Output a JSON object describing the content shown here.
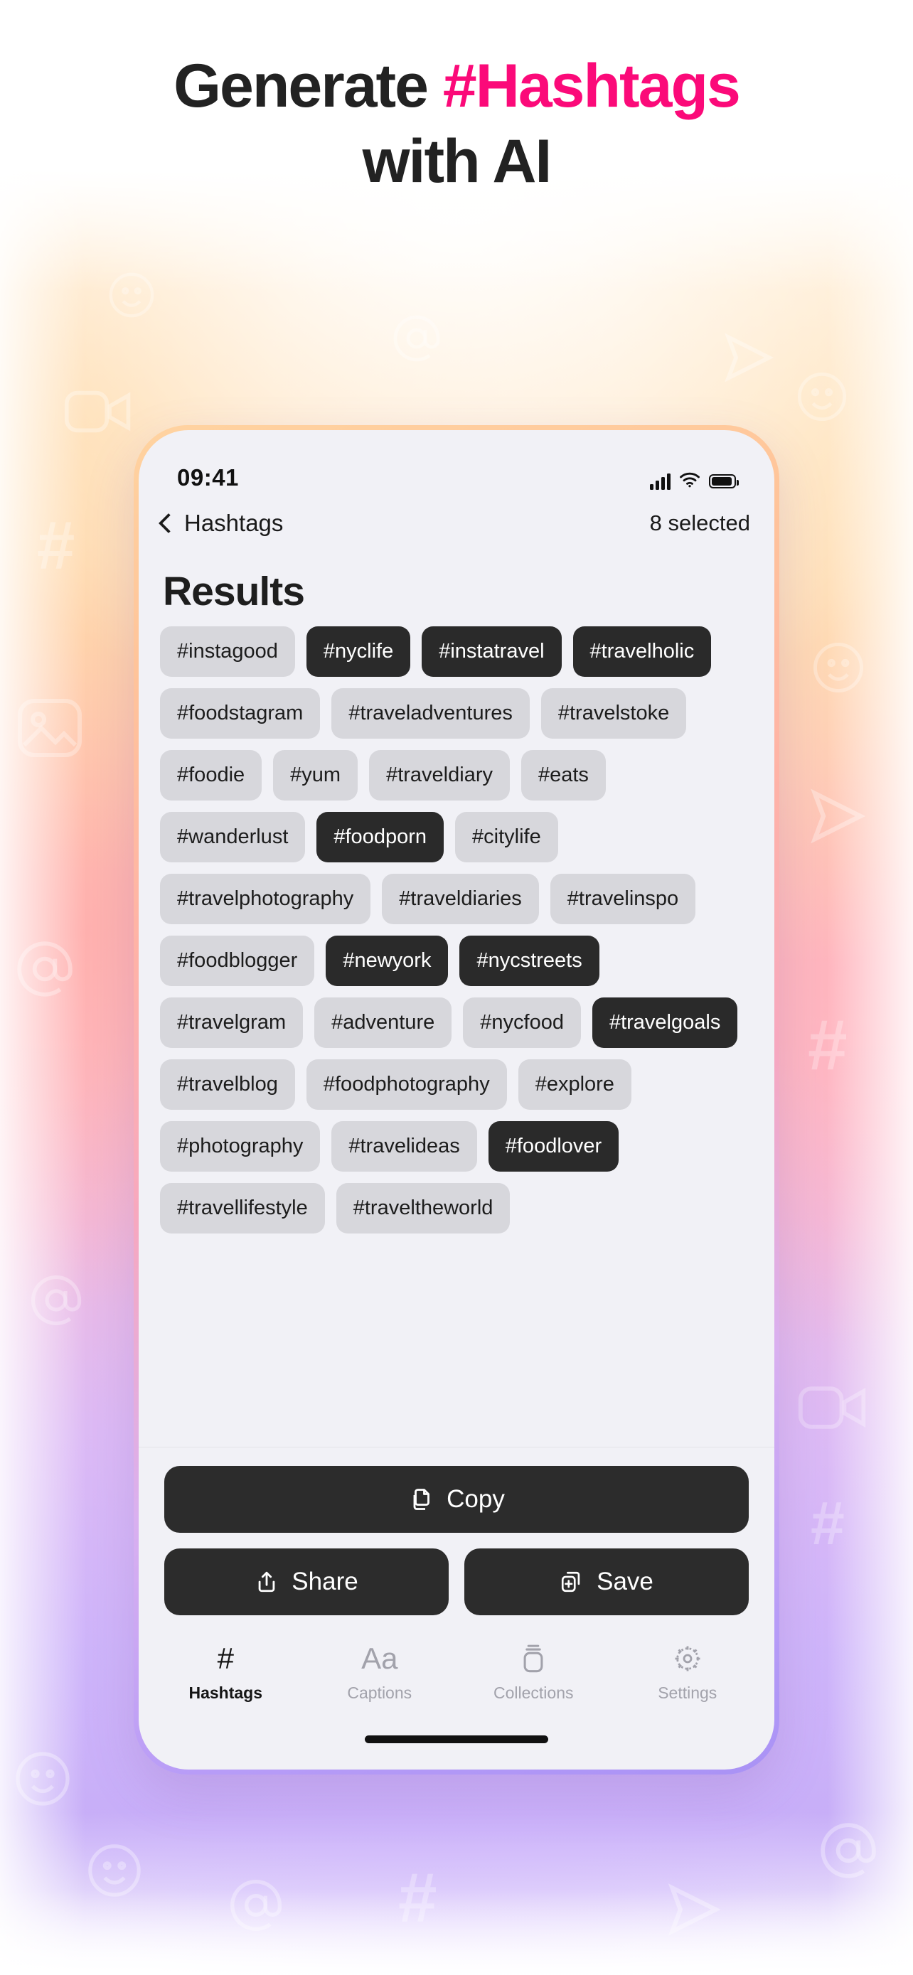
{
  "headline": {
    "line1_plain": "Generate ",
    "line1_accent": "#Hashtags",
    "line2": "with AI",
    "accent_color": "#FB0A79",
    "text_color": "#222222"
  },
  "phone": {
    "status_bar": {
      "time": "09:41",
      "icons": [
        "cellular-signal-icon",
        "wifi-icon",
        "battery-icon"
      ]
    },
    "nav": {
      "back_icon": "chevron-left-icon",
      "back_label": "Hashtags",
      "selected_count": "8 selected"
    },
    "screen_title": "Results",
    "chips": [
      {
        "label": "#instagood",
        "selected": false
      },
      {
        "label": "#nyclife",
        "selected": true
      },
      {
        "label": "#instatravel",
        "selected": true
      },
      {
        "label": "#travelholic",
        "selected": true
      },
      {
        "label": "#foodstagram",
        "selected": false
      },
      {
        "label": "#traveladventures",
        "selected": false
      },
      {
        "label": "#travelstoke",
        "selected": false
      },
      {
        "label": "#foodie",
        "selected": false
      },
      {
        "label": "#yum",
        "selected": false
      },
      {
        "label": "#traveldiary",
        "selected": false
      },
      {
        "label": "#eats",
        "selected": false
      },
      {
        "label": "#wanderlust",
        "selected": false
      },
      {
        "label": "#foodporn",
        "selected": true
      },
      {
        "label": "#citylife",
        "selected": false
      },
      {
        "label": "#travelphotography",
        "selected": false
      },
      {
        "label": "#traveldiaries",
        "selected": false
      },
      {
        "label": "#travelinspo",
        "selected": false
      },
      {
        "label": "#foodblogger",
        "selected": false
      },
      {
        "label": "#newyork",
        "selected": true
      },
      {
        "label": "#nycstreets",
        "selected": true
      },
      {
        "label": "#travelgram",
        "selected": false
      },
      {
        "label": "#adventure",
        "selected": false
      },
      {
        "label": "#nycfood",
        "selected": false
      },
      {
        "label": "#travelgoals",
        "selected": true
      },
      {
        "label": "#travelblog",
        "selected": false
      },
      {
        "label": "#foodphotography",
        "selected": false
      },
      {
        "label": "#explore",
        "selected": false
      },
      {
        "label": "#photography",
        "selected": false
      },
      {
        "label": "#travelideas",
        "selected": false
      },
      {
        "label": "#foodlover",
        "selected": true
      },
      {
        "label": "#travellifestyle",
        "selected": false
      },
      {
        "label": "#traveltheworld",
        "selected": false
      }
    ],
    "actions": {
      "copy": {
        "label": "Copy",
        "icon": "copy-icon"
      },
      "share": {
        "label": "Share",
        "icon": "share-icon"
      },
      "save": {
        "label": "Save",
        "icon": "save-add-icon"
      }
    },
    "tabs": [
      {
        "label": "Hashtags",
        "icon": "hash-icon",
        "glyph": "#",
        "active": true
      },
      {
        "label": "Captions",
        "icon": "text-format-icon",
        "glyph": "Aa",
        "active": false
      },
      {
        "label": "Collections",
        "icon": "collections-stack-icon",
        "glyph": "",
        "active": false
      },
      {
        "label": "Settings",
        "icon": "gear-icon",
        "glyph": "",
        "active": false
      }
    ],
    "chip_colors": {
      "unselected_bg": "#d7d7dc",
      "unselected_text": "#1c1c1c",
      "selected_bg": "#2a2a2a",
      "selected_text": "#ffffff"
    },
    "screen_bg": "#f1f1f6"
  }
}
